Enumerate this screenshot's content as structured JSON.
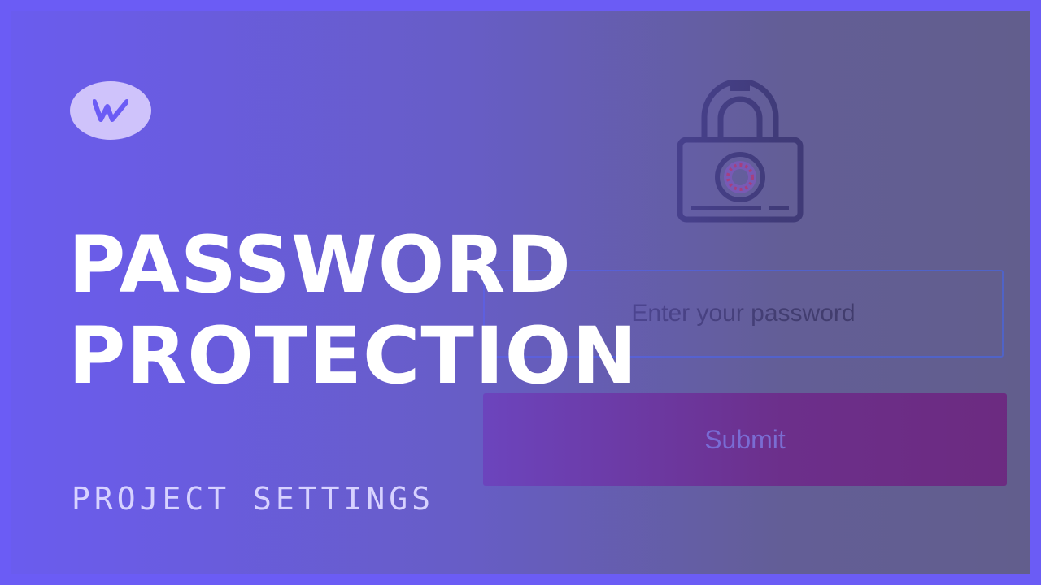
{
  "password_form": {
    "placeholder": "Enter your password",
    "submit_label": "Submit",
    "field_border_color": "#4f63c6",
    "submit_color": "#6c2a7f"
  },
  "title": {
    "line1": "PASSWORD",
    "line2": "PROTECTION"
  },
  "subtitle": "PROJECT SETTINGS",
  "colors": {
    "accent": "#6b5cf5",
    "title_text": "#ffffff",
    "logo_bg": "#cfc3fb"
  },
  "icons": {
    "brand": "webflow-logo-icon",
    "lock": "padlock-icon"
  }
}
